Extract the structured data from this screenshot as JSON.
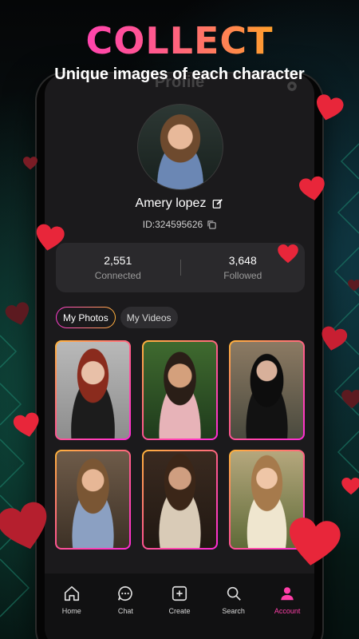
{
  "promo": {
    "headline": "COLLECT",
    "subheadline": "Unique images of each character"
  },
  "profile": {
    "page_title": "Profile",
    "name": "Amery lopez",
    "id_text": "ID:324595626"
  },
  "stats": [
    {
      "value": "2,551",
      "label": "Connected"
    },
    {
      "value": "3,648",
      "label": "Followed"
    }
  ],
  "tabs": [
    {
      "label": "My Photos",
      "active": true
    },
    {
      "label": "My Videos",
      "active": false
    }
  ],
  "bottom_nav": [
    {
      "label": "Home",
      "icon": "home-icon"
    },
    {
      "label": "Chat",
      "icon": "chat-icon"
    },
    {
      "label": "Create",
      "icon": "create-icon"
    },
    {
      "label": "Search",
      "icon": "search-icon"
    },
    {
      "label": "Account",
      "icon": "account-icon",
      "active": true
    }
  ],
  "colors": {
    "accent_pink": "#ff3fa8",
    "gradient_start": "#ff2bd6",
    "gradient_end": "#ffc12b",
    "heart_red": "#e8263a"
  }
}
